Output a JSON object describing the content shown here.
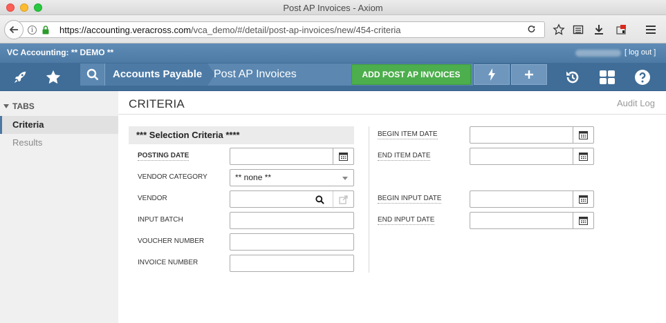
{
  "window": {
    "title": "Post AP Invoices - Axiom"
  },
  "browser": {
    "url_host": "https://accounting.veracross.com",
    "url_path": "/vca_demo/#/detail/post-ap-invoices/new/454-criteria"
  },
  "app": {
    "name": "VC Accounting: ** DEMO **",
    "logout_label": "[ log out ]"
  },
  "toolbar": {
    "breadcrumb_parent": "Accounts Payable",
    "breadcrumb_current": "Post AP Invoices",
    "add_button_label": "ADD POST AP INVOICES"
  },
  "sidebar": {
    "heading": "TABS",
    "items": [
      {
        "label": "Criteria"
      },
      {
        "label": "Results"
      }
    ]
  },
  "page": {
    "title": "CRITERIA",
    "audit_log_label": "Audit Log"
  },
  "criteria": {
    "section_title": "*** Selection Criteria ****",
    "posting_date_label": "POSTING DATE",
    "vendor_category_label": "VENDOR CATEGORY",
    "vendor_category_value": "** none **",
    "vendor_label": "VENDOR",
    "input_batch_label": "INPUT BATCH",
    "voucher_number_label": "VOUCHER NUMBER",
    "invoice_number_label": "INVOICE NUMBER",
    "begin_item_date_label": "BEGIN ITEM DATE",
    "end_item_date_label": "END ITEM DATE",
    "begin_input_date_label": "BEGIN INPUT DATE",
    "end_input_date_label": "END INPUT DATE"
  },
  "colors": {
    "header_blue": "#4c7aa5",
    "toolbar_blue": "#3f6d97",
    "add_button_green": "#4cae4c",
    "sidebar_bg": "#f0f0f0"
  }
}
